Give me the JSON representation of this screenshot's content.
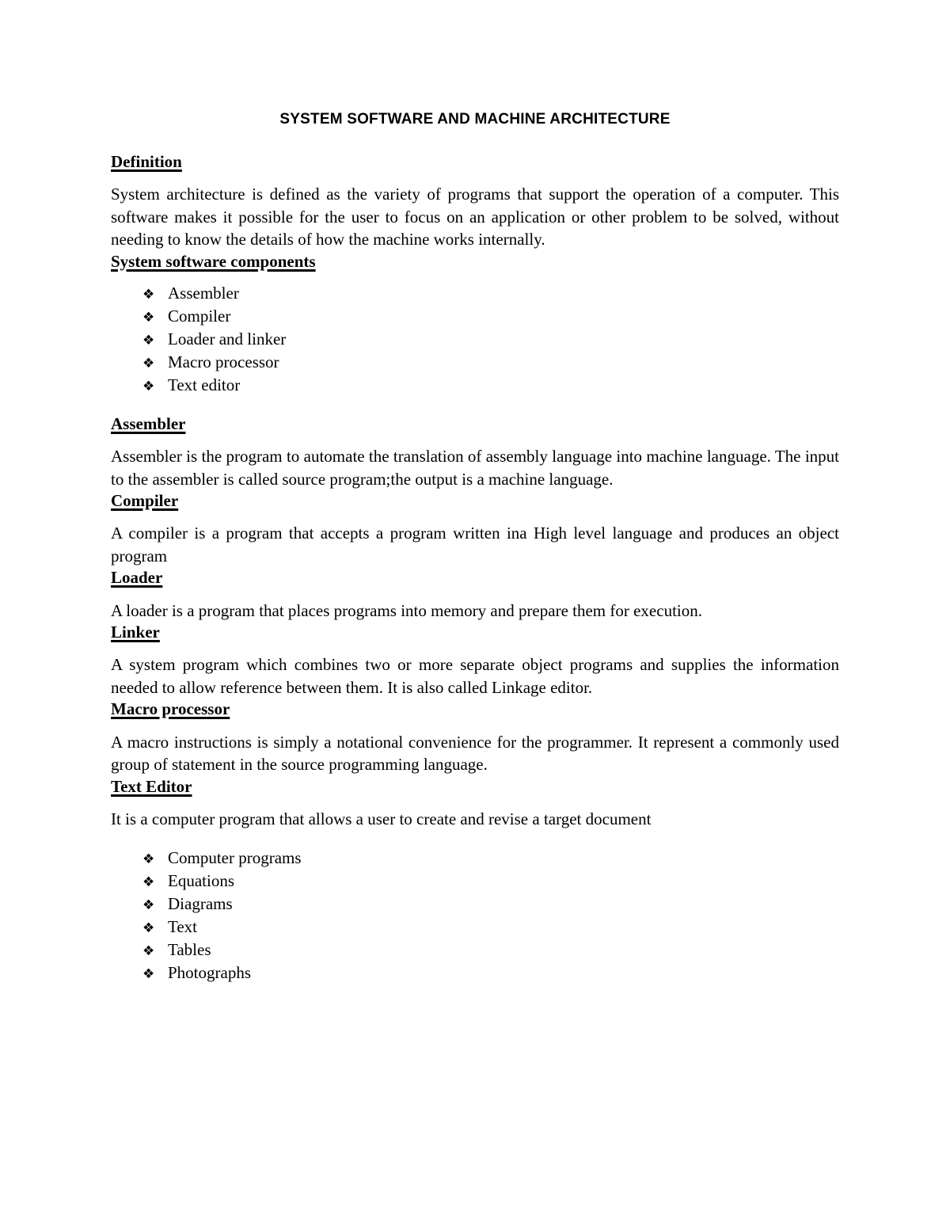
{
  "document": {
    "title": "SYSTEM SOFTWARE AND MACHINE ARCHITECTURE",
    "bullet_glyph": "❖",
    "sections": [
      {
        "heading": "Definition",
        "paragraphs": [
          "System architecture is defined as the variety of programs that support the operation of a computer. This software makes it possible for the user to focus on an application or other problem to be solved, without needing to know the details of how the machine works internally."
        ]
      },
      {
        "heading": "System software components",
        "paragraphs": [],
        "bullets": [
          "Assembler",
          "Compiler",
          "Loader and linker",
          "Macro processor",
          "Text editor"
        ]
      },
      {
        "heading": "Assembler",
        "paragraphs": [
          "Assembler is the program to automate the translation of assembly language into machine language. The input to the assembler is called source program;the output is a machine language."
        ]
      },
      {
        "heading": "Compiler",
        "paragraphs": [
          "A compiler is a program that accepts a program written ina High level language and produces an object program"
        ]
      },
      {
        "heading": "Loader",
        "paragraphs": [
          "A loader is a program that places programs into memory and prepare them for execution."
        ]
      },
      {
        "heading": "Linker",
        "paragraphs": [
          "A system program which combines two or more separate object programs and supplies the information needed to allow reference between them. It is also called Linkage editor."
        ]
      },
      {
        "heading": "Macro processor",
        "paragraphs": [
          "A macro instructions is simply a notational convenience for the programmer. It represent a commonly used group of statement in the source programming language."
        ]
      },
      {
        "heading": "Text Editor",
        "paragraphs": [
          "It is a computer program that allows a user to create and revise a target document"
        ],
        "bullets": [
          "Computer programs",
          "Equations",
          "Diagrams",
          "Text",
          "Tables",
          "Photographs"
        ]
      }
    ]
  }
}
